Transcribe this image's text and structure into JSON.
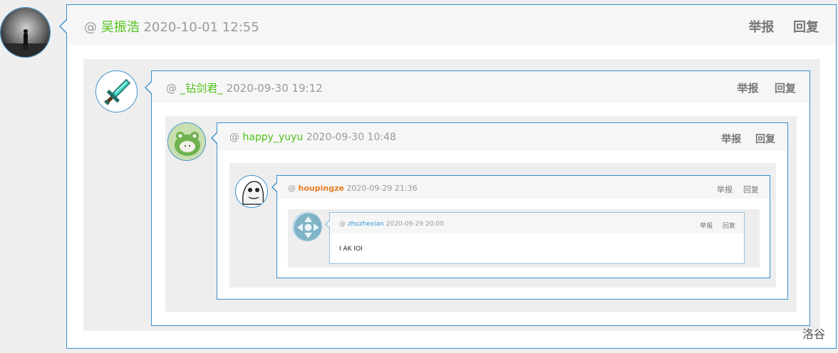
{
  "comments": [
    {
      "level": 1,
      "at": "@",
      "user": "吴振浩",
      "time": "2020-10-01 12:55",
      "report": "举报",
      "reply": "回复"
    },
    {
      "level": 2,
      "at": "@",
      "user": "_钻剑君_",
      "time": "2020-09-30 19:12",
      "report": "举报",
      "reply": "回复"
    },
    {
      "level": 3,
      "at": "@",
      "user": "happy_yuyu",
      "time": "2020-09-30 10:48",
      "report": "举报",
      "reply": "回复"
    },
    {
      "level": 4,
      "at": "@",
      "user": "houpingze",
      "time": "2020-09-29 21:36",
      "report": "举报",
      "reply": "回复"
    },
    {
      "level": 5,
      "at": "@",
      "user": "zhuzhexian",
      "time": "2020-09-29 20:00",
      "report": "举报",
      "reply": "回复",
      "content": "I AK IOI"
    }
  ],
  "footer": {
    "brand": "洛谷"
  },
  "colors": {
    "border": "#3a90c9",
    "username_green": "#52c41a",
    "username_orange": "#e67e22",
    "username_blue": "#3498db"
  }
}
